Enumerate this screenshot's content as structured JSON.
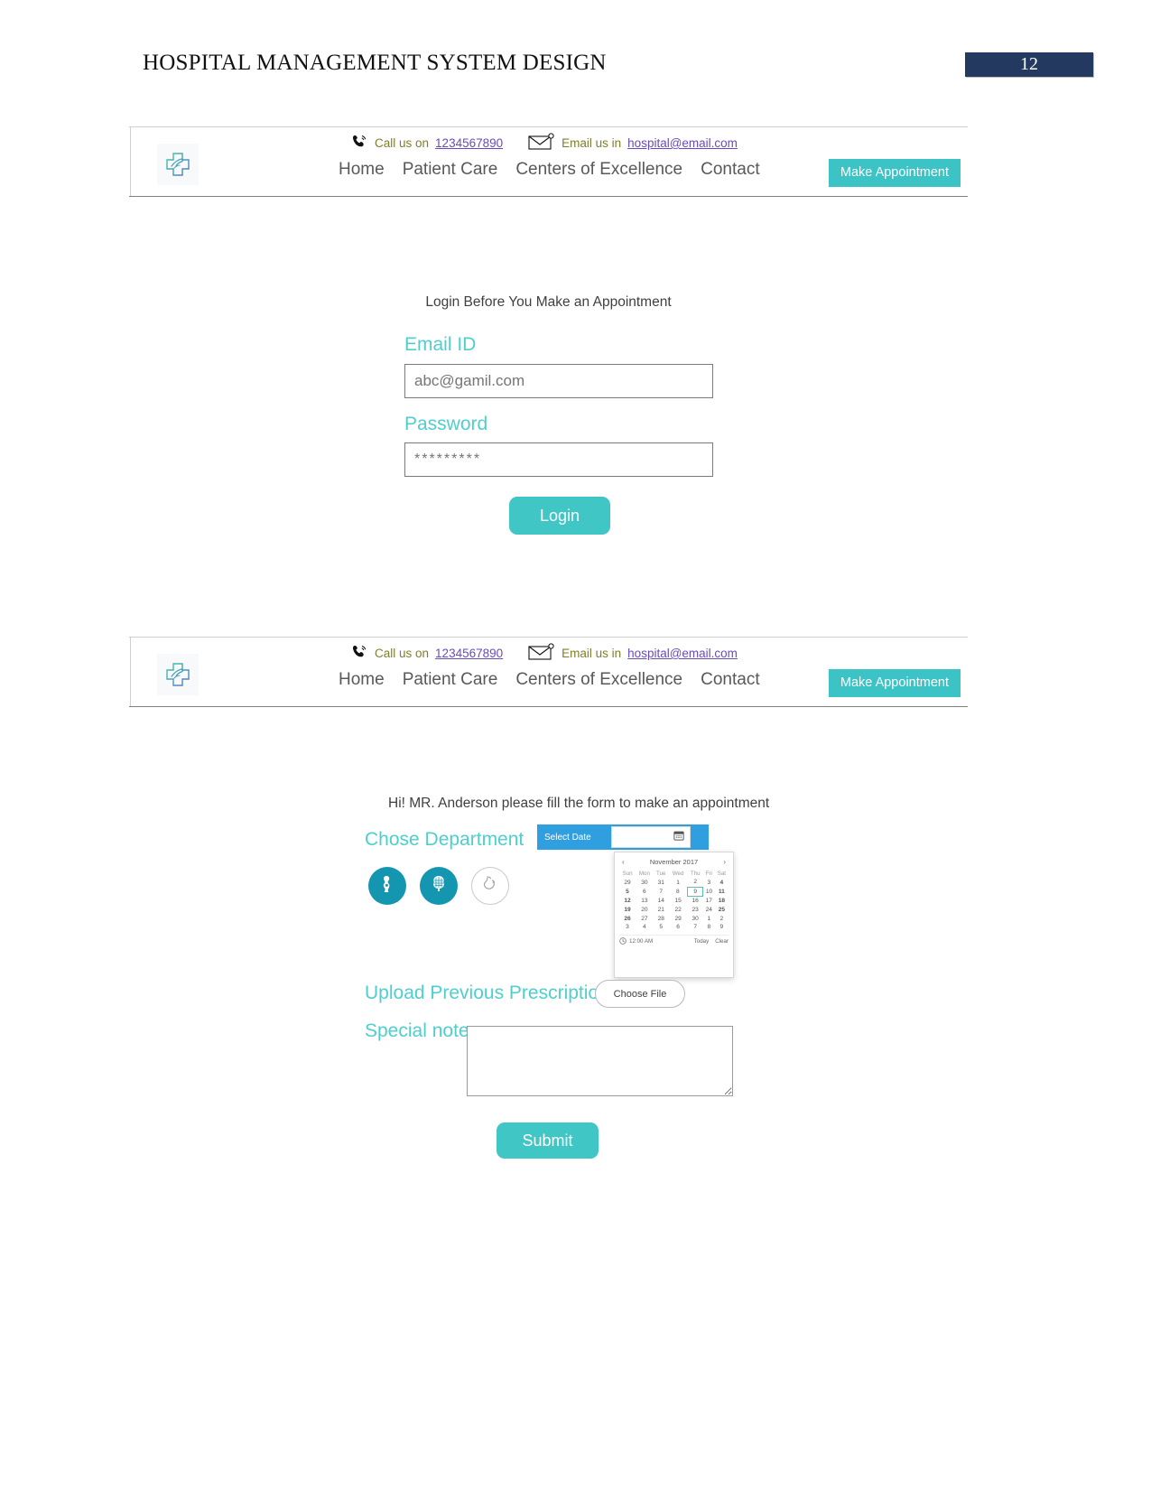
{
  "document": {
    "title": "HOSPITAL MANAGEMENT SYSTEM DESIGN",
    "page_number": "12",
    "badge_color": "#23395f"
  },
  "theme": {
    "teal": "#3fc6c5",
    "label_teal": "#4ecfce",
    "icon_teal": "#1596b0",
    "date_blue": "#2f9fe0",
    "link_purple": "#6a4bbd",
    "contact_olive": "#7f7f2a"
  },
  "header": {
    "logo_name": "medical-cross-hand-logo",
    "contact": {
      "phone_label": "Call us on",
      "phone_value": "1234567890",
      "email_label": "Email us in",
      "email_value": "hospital@email.com"
    },
    "menu": [
      "Home",
      "Patient Care",
      "Centers of Excellence",
      "Contact"
    ],
    "cta_label": "Make Appointment"
  },
  "login_screen": {
    "heading": "Login Before You Make an Appointment",
    "email": {
      "label": "Email ID",
      "placeholder": "abc@gamil.com"
    },
    "password": {
      "label": "Password",
      "placeholder": "*********"
    },
    "submit_label": "Login"
  },
  "appointment_screen": {
    "greeting": "Hi! MR. Anderson please fill the form to make an appointment",
    "department": {
      "label": "Chose Department",
      "options": [
        {
          "name": "orthopedics",
          "icon": "knee-joint-icon",
          "selected": true
        },
        {
          "name": "neurology",
          "icon": "brain-icon",
          "selected": true
        },
        {
          "name": "gastroenterology",
          "icon": "stomach-icon",
          "selected": false
        }
      ]
    },
    "date_picker": {
      "label": "Select Date",
      "value": "",
      "icon": "calendar-icon",
      "calendar": {
        "month_year": "November 2017",
        "prev_label": "‹",
        "next_label": "›",
        "weekdays": [
          "Sun",
          "Mon",
          "Tue",
          "Wed",
          "Thu",
          "Fri",
          "Sat"
        ],
        "weeks": [
          [
            "29",
            "30",
            "31",
            "1",
            "2",
            "3",
            "4"
          ],
          [
            "5",
            "6",
            "7",
            "8",
            "9",
            "10",
            "11"
          ],
          [
            "12",
            "13",
            "14",
            "15",
            "16",
            "17",
            "18"
          ],
          [
            "19",
            "20",
            "21",
            "22",
            "23",
            "24",
            "25"
          ],
          [
            "26",
            "27",
            "28",
            "29",
            "30",
            "1",
            "2"
          ],
          [
            "3",
            "4",
            "5",
            "6",
            "7",
            "8",
            "9"
          ]
        ],
        "muted_cells": [
          "0-0",
          "0-1",
          "0-2",
          "4-5",
          "4-6",
          "5-0",
          "5-1",
          "5-2",
          "5-3",
          "5-4",
          "5-5",
          "5-6"
        ],
        "weekend_cells": [
          "0-6",
          "1-0",
          "1-6",
          "2-0",
          "2-6",
          "3-0",
          "3-6",
          "4-0"
        ],
        "selected_cell": "1-4",
        "time_value": "12:00 AM",
        "today_label": "Today",
        "clear_label": "Clear"
      }
    },
    "upload": {
      "label": "Upload Previous Prescription",
      "button_label": "Choose File"
    },
    "note": {
      "label": "Special note",
      "value": ""
    },
    "submit_label": "Submit"
  }
}
